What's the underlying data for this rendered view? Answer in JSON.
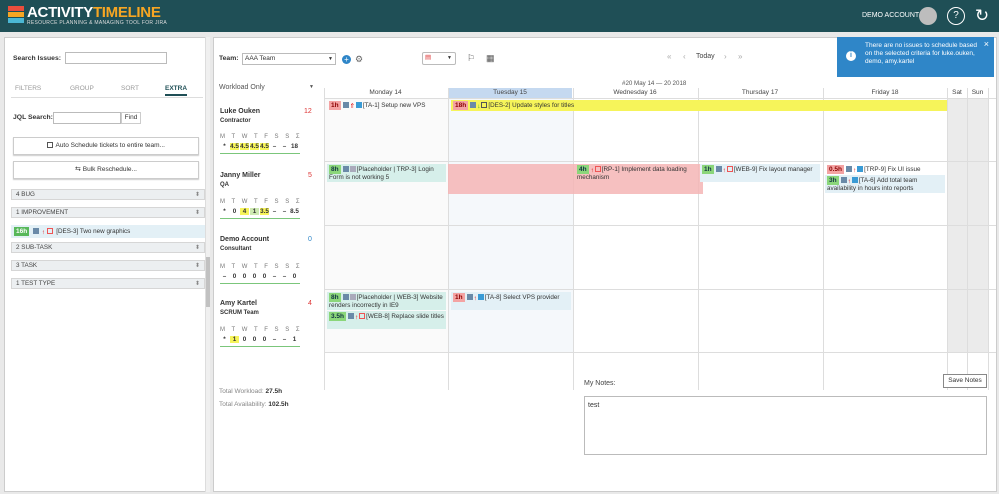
{
  "header": {
    "brand_part1": "ACTIVITY",
    "brand_part2": "TIMELINE",
    "subtitle": "RESOURCE PLANNING & MANAGING TOOL FOR JIRA",
    "account_label": "DEMO ACCOUNT",
    "help_icon": "?",
    "refresh_icon": "↻"
  },
  "left_panel": {
    "search_label": "Search Issues:",
    "search_value": "",
    "tabs": [
      "FILTERS",
      "GROUP",
      "SORT",
      "EXTRA"
    ],
    "active_tab": "EXTRA",
    "jql_label": "JQL Search:",
    "jql_value": "",
    "find_button": "Find",
    "auto_schedule_button": "Auto Schedule tickets to entire team...",
    "bulk_reschedule_button": "Bulk Reschedule...",
    "groups": [
      {
        "label": "4  BUG"
      },
      {
        "label": "1  IMPROVEMENT"
      },
      {
        "label": "2  SUB-TASK"
      },
      {
        "label": "3  TASK"
      },
      {
        "label": "1  TEST TYPE"
      }
    ],
    "improvement_item": {
      "badge": "16h",
      "text": "[DES-3] Two new graphics"
    }
  },
  "main": {
    "team_label": "Team:",
    "team_value": "AAA Team",
    "today_label": "Today",
    "nav": {
      "first": "«",
      "prev": "‹",
      "next": "›",
      "last": "»"
    },
    "workload_dropdown": "Workload Only",
    "week_range": "#20 May 14 — 20 2018",
    "days": [
      "Monday 14",
      "Tuesday 15",
      "Wednesday 16",
      "Thursday 17",
      "Friday 18",
      "Sat",
      "Sun"
    ],
    "weekday_letters": "M T W T F S S Σ",
    "people": [
      {
        "name": "Luke Ouken",
        "role": "Contractor",
        "count": "12",
        "values": [
          "*",
          "4.5",
          "4.5",
          "4.5",
          "4.5",
          "–",
          "–",
          "18"
        ]
      },
      {
        "name": "Janny Miller",
        "role": "QA",
        "count": "5",
        "values": [
          "*",
          "0",
          "4",
          "1",
          "3.5",
          "–",
          "–",
          "8.5"
        ]
      },
      {
        "name": "Demo Account",
        "role": "Consultant",
        "count": "0",
        "values": [
          "–",
          "0",
          "0",
          "0",
          "0",
          "–",
          "–",
          "0"
        ]
      },
      {
        "name": "Amy Kartel",
        "role": "SCRUM Team",
        "count": "4",
        "values": [
          "*",
          "1",
          "0",
          "0",
          "0",
          "–",
          "–",
          "1"
        ]
      }
    ],
    "tasks": {
      "t1": {
        "badge": "1h",
        "text": "[TA-1] Setup new VPS"
      },
      "t2": {
        "badge": "18h",
        "text": "[DES-2] Update styles for titles"
      },
      "t3": {
        "badge": "8h",
        "text": "[Placeholder | TRP-3] Login Form is not working 5"
      },
      "t4": {
        "badge": "4h",
        "text": "[RP-1] Implement data loading mechanism"
      },
      "t5": {
        "badge": "1h",
        "text": "[WEB-9] Fix layout manager"
      },
      "t6": {
        "badge": "0.5h",
        "text": "[TRP-9] Fix UI issue"
      },
      "t7": {
        "badge": "3h",
        "text": "[TA-6] Add total team availability in hours into reports"
      },
      "t8": {
        "badge": "8h",
        "text": "[Placeholder | WEB-3] Website renders incorrectly in IE9"
      },
      "t9": {
        "badge": "3.5h",
        "text": "[WEB-8] Replace slide titles"
      },
      "t10": {
        "badge": "1h",
        "text": "[TA-8] Select VPS provider"
      }
    },
    "total_workload_label": "Total Workload:",
    "total_workload_value": "27.5h",
    "total_availability_label": "Total Availability:",
    "total_availability_value": "102.5h",
    "notes_label": "My Notes:",
    "save_notes_button": "Save Notes",
    "notes_value": "test"
  },
  "notification": {
    "text": "There are no issues to schedule based on the selected criteria for luke.ouken, demo, amy.kartel",
    "close": "×"
  },
  "colors": {
    "header_bg": "#1f4f56",
    "accent": "#f6a623",
    "notify_bg": "#2f86c8"
  }
}
